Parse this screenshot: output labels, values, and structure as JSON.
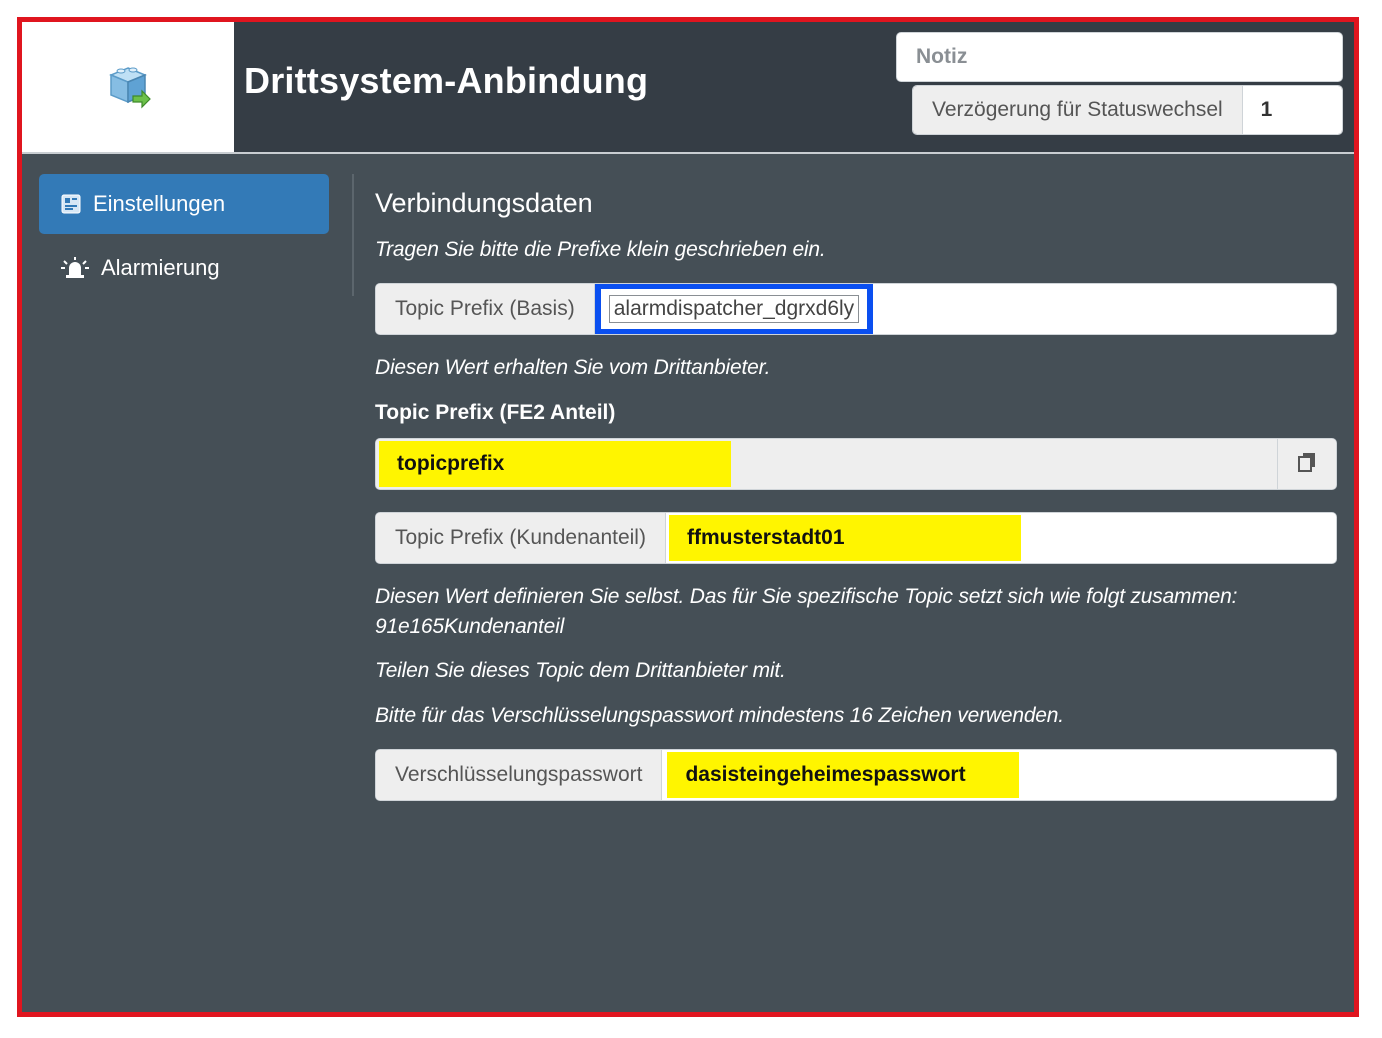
{
  "header": {
    "title": "Drittsystem-Anbindung",
    "note_placeholder": "Notiz",
    "delay_label": "Verzögerung für Statuswechsel",
    "delay_value": "1"
  },
  "sidebar": {
    "items": [
      {
        "label": "Einstellungen",
        "icon": "settings-icon",
        "active": true
      },
      {
        "label": "Alarmierung",
        "icon": "siren-icon",
        "active": false
      }
    ]
  },
  "main": {
    "section_title": "Verbindungsdaten",
    "hint_prefix_lowercase": "Tragen Sie bitte die Prefixe klein geschrieben ein.",
    "basis": {
      "label": "Topic Prefix (Basis)",
      "value": "alarmdispatcher_dgrxd6ly"
    },
    "hint_from_provider": "Diesen Wert erhalten Sie vom Drittanbieter.",
    "fe2_label": "Topic Prefix (FE2 Anteil)",
    "fe2_value": "topicprefix",
    "customer": {
      "label": "Topic Prefix (Kundenanteil)",
      "value": "ffmusterstadt01"
    },
    "hint_define_line1": "Diesen Wert definieren Sie selbst. Das für Sie spezifische Topic setzt sich wie folgt zusammen:",
    "hint_define_line2": "91e165Kundenanteil",
    "hint_share": "Teilen Sie dieses Topic dem Drittanbieter mit.",
    "hint_password": "Bitte für das Verschlüsselungspasswort mindestens 16 Zeichen verwenden.",
    "password": {
      "label": "Verschlüsselungspasswort",
      "value": "dasisteingeheimespasswort"
    }
  },
  "colors": {
    "frame_border": "#e0151f",
    "highlight_yellow": "#fff500",
    "highlight_blue": "#0a4ff0",
    "active_nav": "#337ab7"
  }
}
